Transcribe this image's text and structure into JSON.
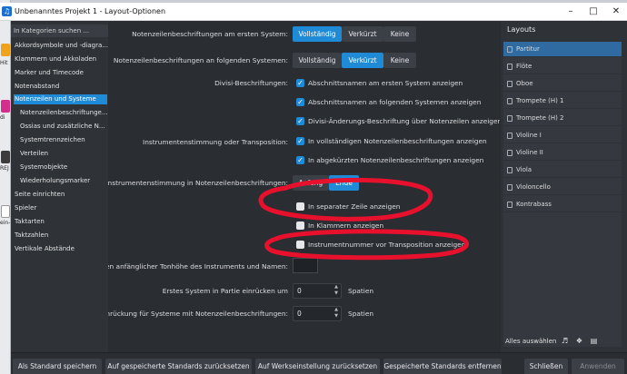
{
  "window": {
    "title": "Unbenanntes Projekt 1 - Layout-Optionen",
    "minimize_glyph": "–",
    "maximize_glyph": "□",
    "close_glyph": "✕"
  },
  "taskbar": {
    "items": [
      "Hit",
      "di",
      "REJ",
      "ein-"
    ]
  },
  "sidebar": {
    "search_placeholder": "In Kategorien suchen ...",
    "items": [
      {
        "label": "Akkordsymbole und -diagra..."
      },
      {
        "label": "Klammern und Akkoladen"
      },
      {
        "label": "Marker und Timecode"
      },
      {
        "label": "Notenabstand"
      },
      {
        "label": "Notenzeilen und Systeme"
      },
      {
        "label": "Notenzeilenbeschriftunge..."
      },
      {
        "label": "Ossias und zusätzliche N..."
      },
      {
        "label": "Systemtrennzeichen"
      },
      {
        "label": "Verteilen"
      },
      {
        "label": "Systemobjekte"
      },
      {
        "label": "Wiederholungsmarker"
      },
      {
        "label": "Seite einrichten"
      },
      {
        "label": "Spieler"
      },
      {
        "label": "Taktarten"
      },
      {
        "label": "Taktzahlen"
      },
      {
        "label": "Vertikale Abstände"
      }
    ]
  },
  "main": {
    "first_system_label": "Notenzeilenbeschriftungen am ersten System:",
    "first_system_options": [
      "Vollständig",
      "Verkürzt",
      "Keine"
    ],
    "following_label": "Notenzeilenbeschriftungen an folgenden Systemen:",
    "following_options": [
      "Vollständig",
      "Verkürzt",
      "Keine"
    ],
    "divisi_label": "Divisi-Beschriftungen:",
    "divisi_checks": [
      {
        "label": "Abschnittsnamen am ersten System anzeigen",
        "checked": true
      },
      {
        "label": "Abschnittsnamen an folgenden Systemen anzeigen",
        "checked": true
      },
      {
        "label": "Divisi-Änderungs-Beschriftung über Notenzeilen anzeigen",
        "checked": true
      }
    ],
    "tuning_label": "Instrumentenstimmung oder Transposition:",
    "tuning_checks": [
      {
        "label": "In vollständigen Notenzeilenbeschriftungen anzeigen",
        "checked": true
      },
      {
        "label": "In abgekürzten Notenzeilenbeschriftungen anzeigen",
        "checked": true
      }
    ],
    "position_label": "ler Instrumentenstimmung in Notenzeilenbeschriftungen:",
    "position_options": [
      "Anfang",
      "Ende"
    ],
    "extra_checks": [
      {
        "label": "In separater Zeile anzeigen",
        "checked": false
      },
      {
        "label": "In Klammern anzeigen",
        "checked": false
      },
      {
        "label": "Instrumentnummer vor Transposition anzeigen",
        "checked": false
      }
    ],
    "pitch_label": "schen anfänglicher Tonhöhe des Instruments und Namen:",
    "indent_first_label": "Erstes System in Partie einrücken um",
    "indent_first_value": "0",
    "indent_first_unit": "Spatien",
    "indent_labels_label": "steinrückung für Systeme mit Notenzeilenbeschriftungen:",
    "indent_labels_value": "0",
    "indent_labels_unit": "Spatien",
    "annotation_color": "#e8112d"
  },
  "layouts": {
    "heading": "Layouts",
    "items": [
      {
        "label": "Partitur"
      },
      {
        "label": "Flöte"
      },
      {
        "label": "Oboe"
      },
      {
        "label": "Trompete (H) 1"
      },
      {
        "label": "Trompete (H) 2"
      },
      {
        "label": "Violine I"
      },
      {
        "label": "Violine II"
      },
      {
        "label": "Viola"
      },
      {
        "label": "Violoncello"
      },
      {
        "label": "Kontrabass"
      }
    ],
    "select_all_label": "Alles auswählen"
  },
  "footer": {
    "buttons": [
      "Als Standard speichern",
      "Auf gespeicherte Standards zurücksetzen",
      "Auf Werkseinstellung zurücksetzen",
      "Gespeicherte Standards entfernen",
      "Schließen",
      "Anwenden"
    ]
  },
  "colors": {
    "accent": "#1f8ad6",
    "background": "#2a2d32",
    "panel": "#2f3237"
  }
}
